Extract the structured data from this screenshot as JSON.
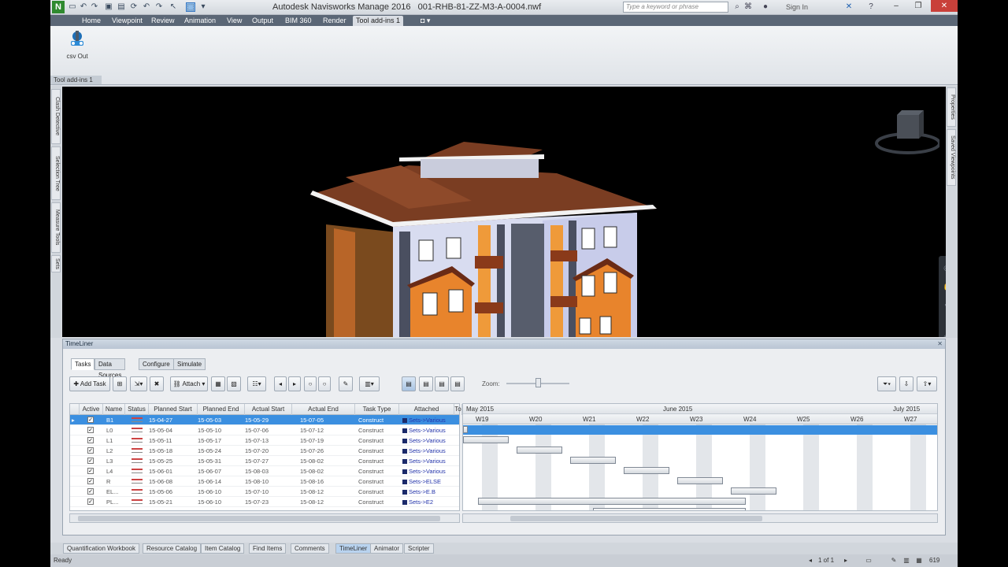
{
  "app": {
    "logo_letter": "N",
    "title": "Autodesk Navisworks Manage 2016",
    "file": "001-RHB-81-ZZ-M3-A-0004.nwf",
    "search_placeholder": "Type a keyword or phrase",
    "signin": "Sign In",
    "window_controls": [
      "–",
      "❐",
      "✕"
    ]
  },
  "ribbon": {
    "tabs": [
      "Home",
      "Viewpoint",
      "Review",
      "Animation",
      "View",
      "Output",
      "BIM 360",
      "Render",
      "Tool add-ins 1"
    ],
    "active_tab": "Tool add-ins 1",
    "button_label": "csv Out",
    "panel_label": "Tool add-ins 1"
  },
  "side_tabs": {
    "left": [
      "Clash Detective",
      "Selection Tree",
      "Measure Tools",
      "Sets"
    ],
    "right": [
      "Properties",
      "Saved Viewpoints"
    ]
  },
  "timeliner": {
    "title": "TimeLiner",
    "close": "✕",
    "tabs": [
      "Tasks",
      "Data Sources",
      "Configure",
      "Simulate"
    ],
    "active_tab": "Tasks",
    "toolbar": {
      "add_task": "Add Task",
      "attach": "Attach",
      "zoom_label": "Zoom:"
    },
    "columns": [
      "Active",
      "Name",
      "Status",
      "Planned Start",
      "Planned End",
      "Actual Start",
      "Actual End",
      "Task Type",
      "Attached",
      "To"
    ],
    "rows": [
      {
        "name": "B1",
        "ps": "15-04-27",
        "pe": "15-05-03",
        "as": "15-05-29",
        "ae": "15-07-05",
        "type": "Construct",
        "att": "Sets->Various",
        "sel": true
      },
      {
        "name": "L0",
        "ps": "15-05-04",
        "pe": "15-05-10",
        "as": "15-07-06",
        "ae": "15-07-12",
        "type": "Construct",
        "att": "Sets->Various",
        "sel": false
      },
      {
        "name": "L1",
        "ps": "15-05-11",
        "pe": "15-05-17",
        "as": "15-07-13",
        "ae": "15-07-19",
        "type": "Construct",
        "att": "Sets->Various",
        "sel": false
      },
      {
        "name": "L2",
        "ps": "15-05-18",
        "pe": "15-05-24",
        "as": "15-07-20",
        "ae": "15-07-26",
        "type": "Construct",
        "att": "Sets->Various",
        "sel": false
      },
      {
        "name": "L3",
        "ps": "15-05-25",
        "pe": "15-05-31",
        "as": "15-07-27",
        "ae": "15-08-02",
        "type": "Construct",
        "att": "Sets->Various",
        "sel": false
      },
      {
        "name": "L4",
        "ps": "15-06-01",
        "pe": "15-06-07",
        "as": "15-08-03",
        "ae": "15-08-02",
        "type": "Construct",
        "att": "Sets->Various",
        "sel": false
      },
      {
        "name": "R",
        "ps": "15-06-08",
        "pe": "15-06-14",
        "as": "15-08-10",
        "ae": "15-08-16",
        "type": "Construct",
        "att": "Sets->ELSE",
        "sel": false
      },
      {
        "name": "EL...",
        "ps": "15-05-06",
        "pe": "15-06-10",
        "as": "15-07-10",
        "ae": "15-08-12",
        "type": "Construct",
        "att": "Sets->E.B",
        "sel": false
      },
      {
        "name": "PL...",
        "ps": "15-05-21",
        "pe": "15-06-10",
        "as": "15-07-23",
        "ae": "15-08-12",
        "type": "Construct",
        "att": "Sets->E2",
        "sel": false
      }
    ],
    "gantt": {
      "months": [
        "May 2015",
        "June 2015",
        "July 2015"
      ],
      "weeks": [
        "W19",
        "W20",
        "W21",
        "W22",
        "W23",
        "W24",
        "W25",
        "W26",
        "W27"
      ]
    }
  },
  "bottom_tabs": [
    "Quantification Workbook",
    "Resource Catalog",
    "Item Catalog",
    "Find Items",
    "Comments",
    "TimeLiner",
    "Animator",
    "Scripter"
  ],
  "bottom_active": "TimeLiner",
  "status": {
    "text": "Ready",
    "page": "1 of 1"
  }
}
